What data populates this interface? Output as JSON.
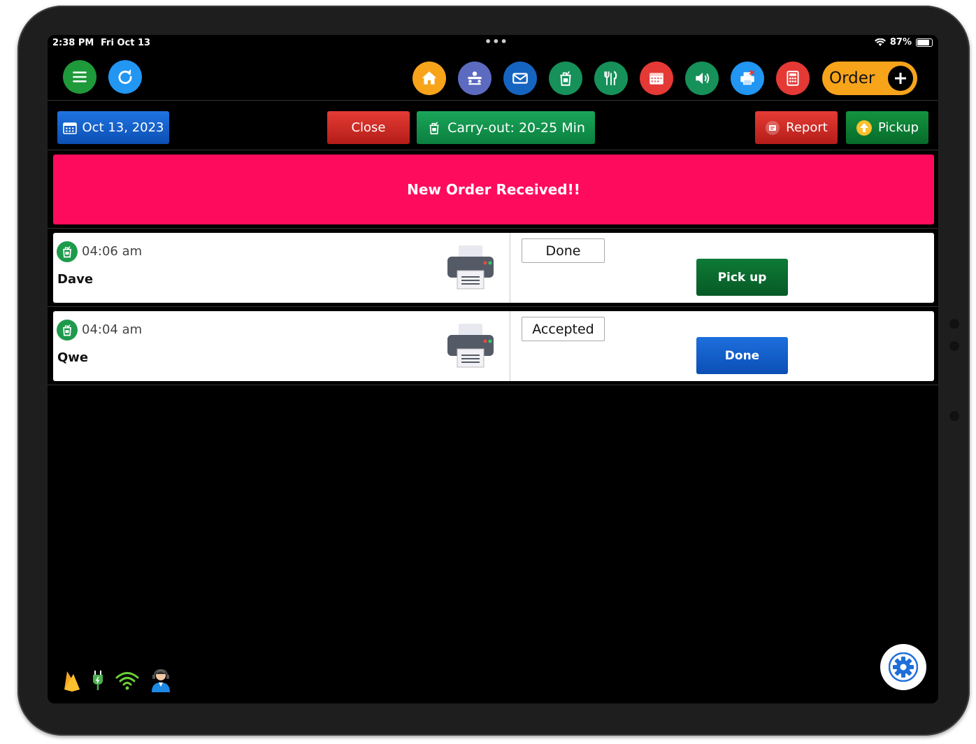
{
  "status_bar": {
    "time": "2:38 PM",
    "date": "Fri Oct 13",
    "battery": "87%",
    "battery_level": 0.87
  },
  "toolbar": {
    "icons": [
      "menu-icon",
      "refresh-icon",
      "home-icon",
      "staff-icon",
      "mail-icon",
      "carryout-icon",
      "dine-in-icon",
      "calendar-icon",
      "volume-icon",
      "printer-off-icon",
      "calculator-icon"
    ],
    "order_label": "Order",
    "colors": {
      "green": "#1e9a3a",
      "blue": "#2196f3",
      "orange": "#f7a41b",
      "red": "#e53935",
      "indigo": "#5c6bc0",
      "navy": "#1565c0",
      "teal": "#16915a"
    }
  },
  "actions": {
    "date_label": "Oct 13, 2023",
    "close_label": "Close",
    "carryout_label": "Carry-out: 20-25 Min",
    "report_label": "Report",
    "pickup_label": "Pickup"
  },
  "banner": {
    "text": "New Order Received!!",
    "color": "#ff0b5e"
  },
  "orders": [
    {
      "time": "04:06 am",
      "name": "Dave",
      "status": "Done",
      "action": "Pick up",
      "action_color": "green"
    },
    {
      "time": "04:04 am",
      "name": "Qwe",
      "status": "Accepted",
      "action": "Done",
      "action_color": "blue"
    }
  ],
  "bottom_icons": [
    "firebase-icon",
    "power-plug-icon",
    "wifi-icon",
    "support-agent-icon"
  ]
}
